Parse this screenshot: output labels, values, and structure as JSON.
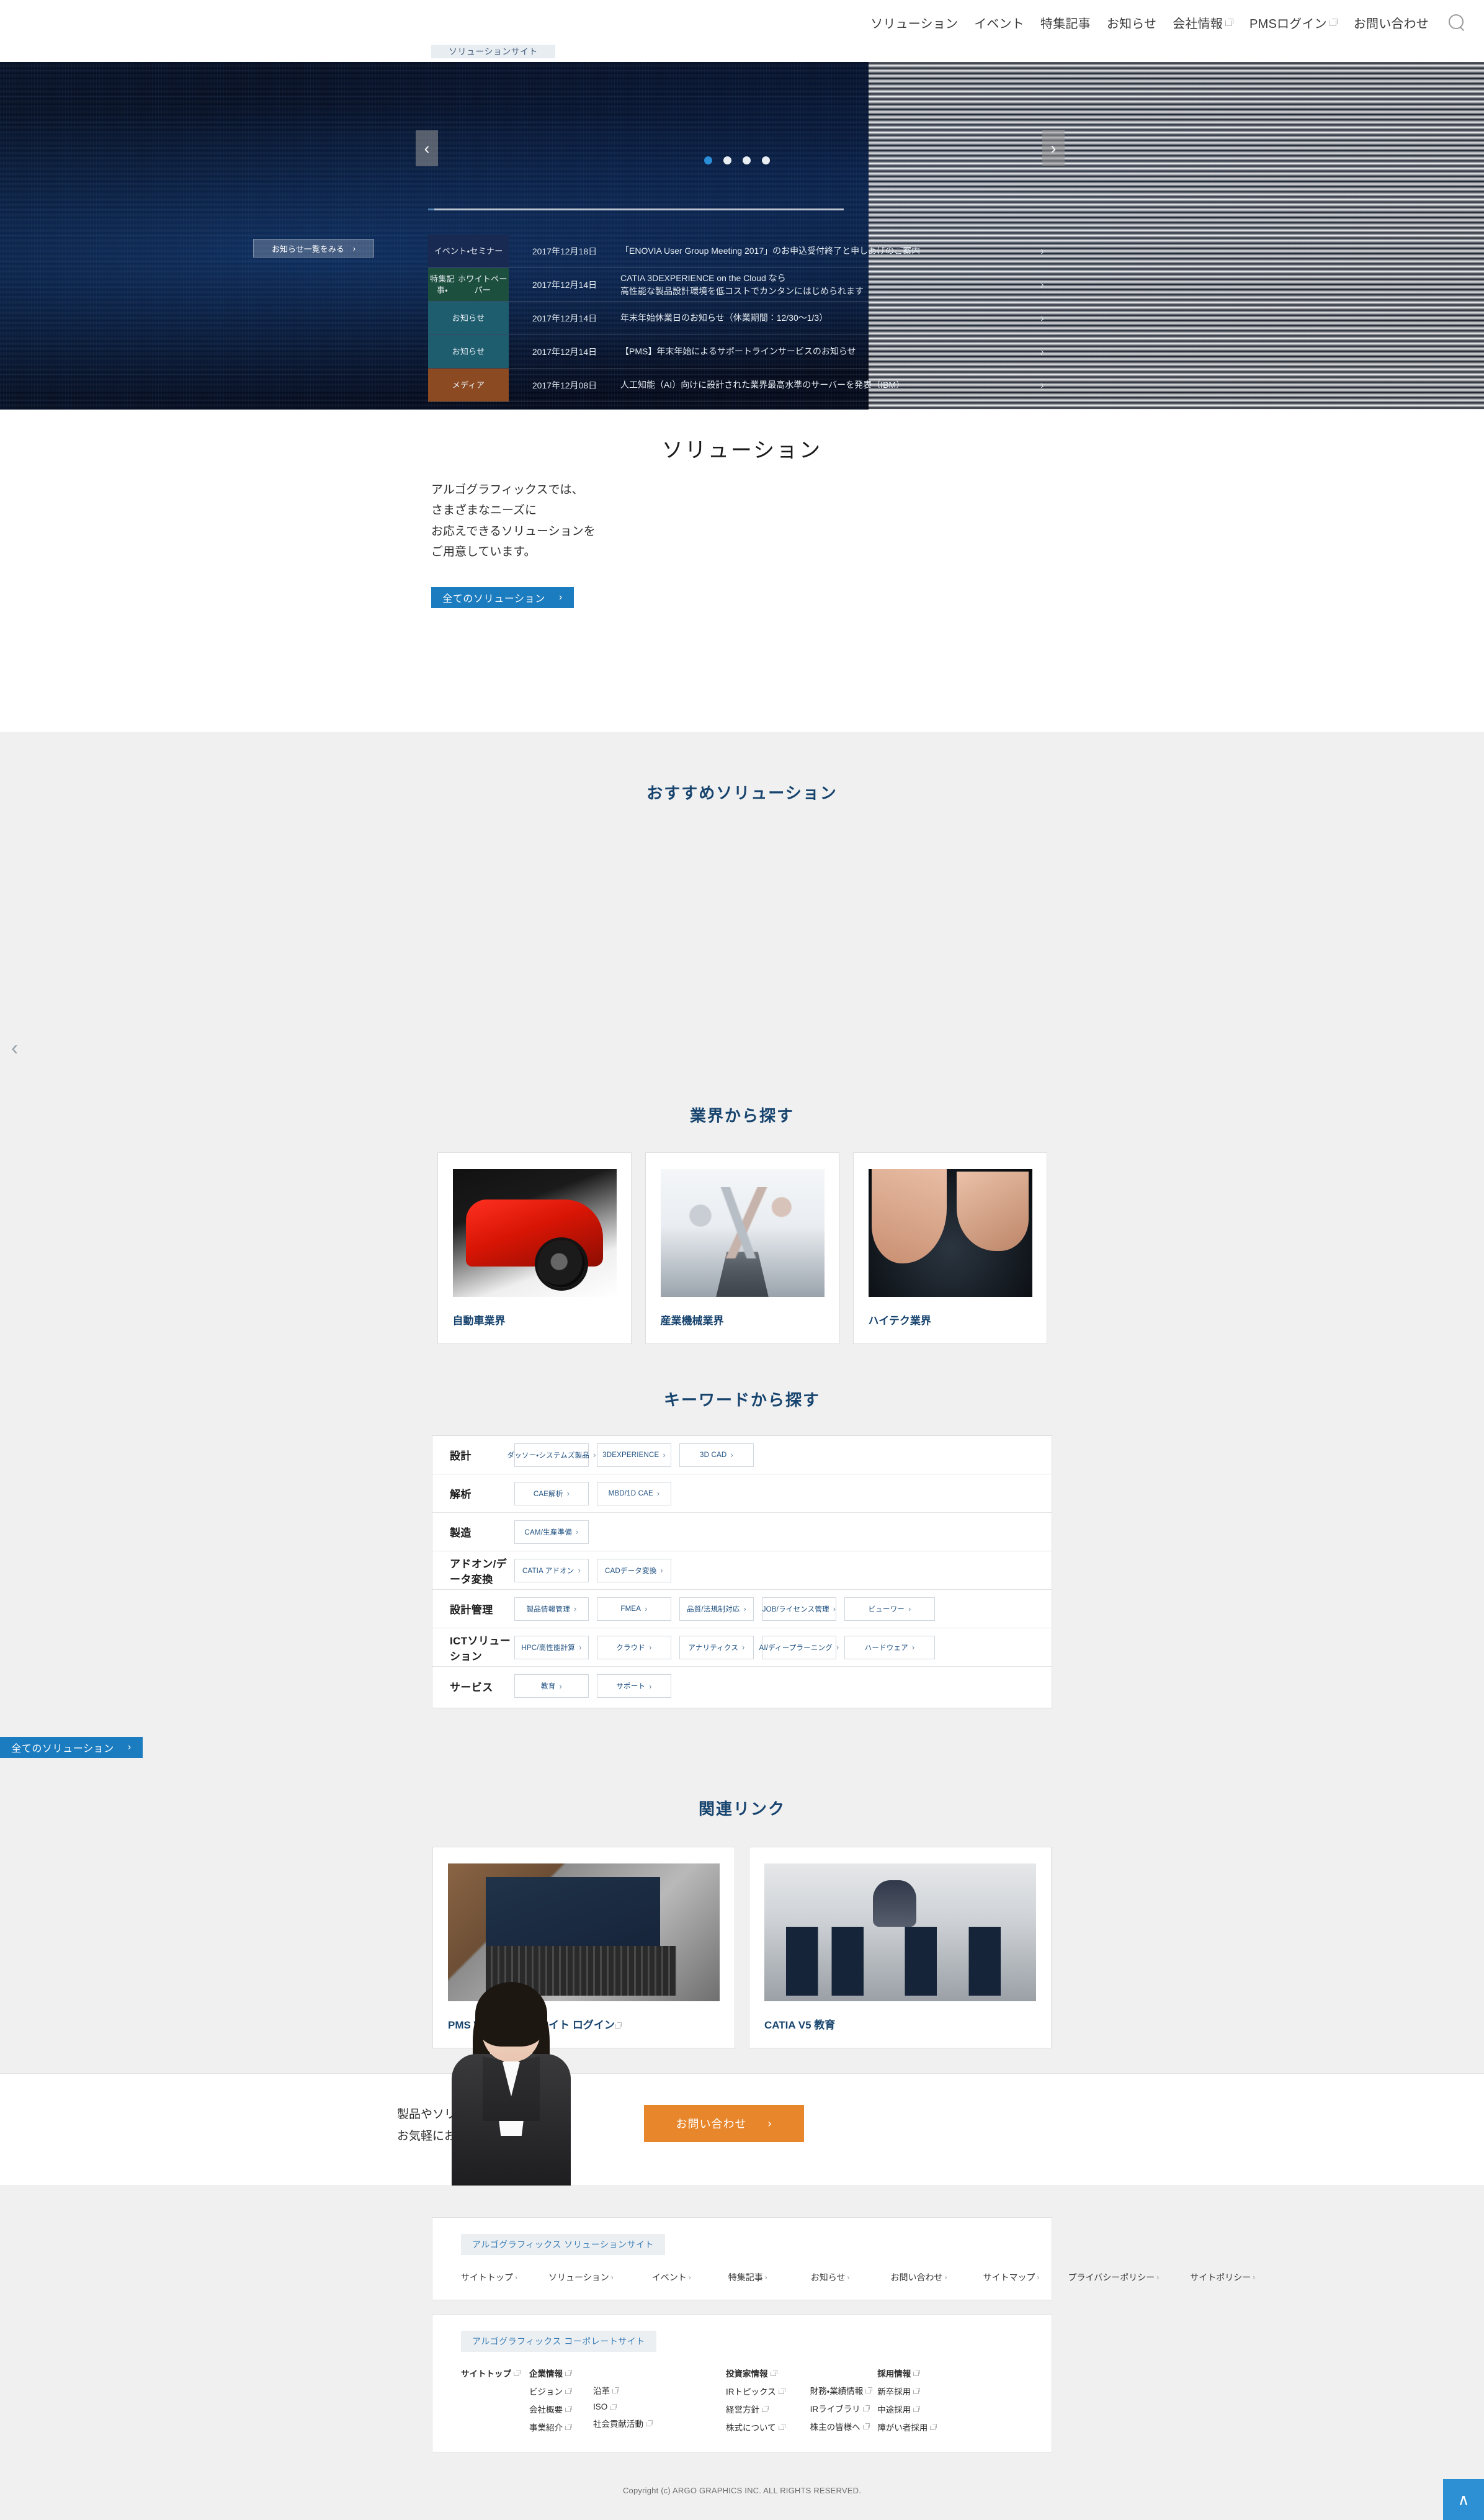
{
  "header": {
    "nav": [
      {
        "label": "ソリューション",
        "external": false
      },
      {
        "label": "イベント",
        "external": false
      },
      {
        "label": "特集記事",
        "external": false
      },
      {
        "label": "お知らせ",
        "external": false
      },
      {
        "label": "会社情報",
        "external": true
      },
      {
        "label": "PMSログイン",
        "external": true
      },
      {
        "label": "お問い合わせ",
        "external": false
      }
    ],
    "search_icon": "search-icon"
  },
  "breadcrumb": {
    "label": "ソリューションサイト"
  },
  "hero": {
    "prev_label": "‹",
    "next_label": "›",
    "dots": 4,
    "active_dot": 0,
    "more_label": "お知らせ一覧をみる",
    "more_chevron": "›",
    "news": [
      {
        "category": "イベント・\nセミナー",
        "date": "2017年12月18日",
        "title": "「ENOVIA User Group Meeting 2017」のお申込受付終了と申しあげのご案内",
        "chevron": "›"
      },
      {
        "category": "特集記事・\nホワイトペーパー",
        "date": "2017年12月14日",
        "title": "CATIA 3DEXPERIENCE on the Cloud なら\n高性能な製品設計環境を低コストでカンタンにはじめられます",
        "chevron": "›"
      },
      {
        "category": "お知らせ",
        "date": "2017年12月14日",
        "title": "年末年始休業日のお知らせ（休業期間：12/30～1/3）",
        "chevron": "›"
      },
      {
        "category": "お知らせ",
        "date": "2017年12月14日",
        "title": "【PMS】年末年始によるサポートラインサービスのお知らせ",
        "chevron": "›"
      },
      {
        "category": "メディア",
        "date": "2017年12月08日",
        "title": "人工知能（AI）向けに設計された業界最高水準のサーバーを発表（IBM）",
        "chevron": "›"
      }
    ]
  },
  "solution": {
    "title": "ソリューション",
    "body_lines": [
      "アルゴグラフィックスでは、",
      "さまざまなニーズに",
      "お応えできるソリューションを",
      "ご用意しています。"
    ],
    "button": "全てのソリューション",
    "button_chevron": "›"
  },
  "recommended": {
    "title": "おすすめソリューション",
    "prev_arrow": "‹"
  },
  "industry": {
    "title": "業界から探す",
    "cards": [
      {
        "label": "自動車業界",
        "thumb": "sports-car-photo"
      },
      {
        "label": "産業機械業界",
        "thumb": "industrial-robot-arms-photo"
      },
      {
        "label": "ハイテク業界",
        "thumb": "semiconductor-wafer-photo"
      }
    ]
  },
  "keyword": {
    "title": "キーワードから探す",
    "chevron": "›",
    "rows": [
      {
        "label": "設計",
        "items": [
          "ダッソー・システムズ製品",
          "3DEXPERIENCE",
          "3D CAD"
        ]
      },
      {
        "label": "解析",
        "items": [
          "CAE解析",
          "MBD/1D CAE"
        ]
      },
      {
        "label": "製造",
        "items": [
          "CAM/生産準備"
        ]
      },
      {
        "label": "アドオン/データ変換",
        "items": [
          "CATIA アドオン",
          "CADデータ変換"
        ]
      },
      {
        "label": "設計管理",
        "items": [
          "製品情報管理",
          "FMEA",
          "品質/法規制対応",
          "JOB/ライセンス管理",
          "ビューワー"
        ]
      },
      {
        "label": "ICTソリューション",
        "items": [
          "HPC/高性能計算",
          "クラウド",
          "アナリティクス",
          "AI/ディープラーニング",
          "ハードウェア"
        ]
      },
      {
        "label": "サービス",
        "items": [
          "教育",
          "サポート"
        ]
      }
    ],
    "all_button": "全てのソリューション",
    "all_button_chevron": "›"
  },
  "related": {
    "title": "関連リンク",
    "cards": [
      {
        "label": "PMS Webサポートサイト ログイン",
        "external": true,
        "thumb": "laptop-support-photo"
      },
      {
        "label": "CATIA V5 教育",
        "external": false,
        "thumb": "classroom-training-photo"
      }
    ]
  },
  "contact": {
    "line1": "製品やソリューションについて、",
    "line2": "お気軽にお問い合わせください。",
    "button": "お問い合わせ",
    "button_chevron": "›"
  },
  "footer": {
    "solution_site": {
      "tag": "アルゴグラフィックス ソリューションサイト",
      "links": [
        {
          "label": "サイトトップ"
        },
        {
          "label": "ソリューション"
        },
        {
          "label": "イベント"
        },
        {
          "label": "特集記事"
        },
        {
          "label": "お知らせ"
        },
        {
          "label": "お問い合わせ"
        },
        {
          "label": "サイトマップ"
        },
        {
          "label": "プライバシーポリシー"
        },
        {
          "label": "サイトポリシー"
        }
      ],
      "chevron": "›"
    },
    "corporate_site": {
      "tag": "アルゴグラフィックス コーポレートサイト",
      "columns": [
        {
          "head": "サイトトップ",
          "items": []
        },
        {
          "head": "企業情報",
          "items": [
            "ビジョン",
            "会社概要",
            "事業紹介"
          ]
        },
        {
          "head": "",
          "items": [
            "沿革",
            "ISO",
            "社会貢献活動"
          ]
        },
        {
          "head": "投資家情報",
          "items": [
            "IRトピックス",
            "経営方針",
            "株式について"
          ]
        },
        {
          "head": "",
          "items": [
            "財務・業績情報",
            "IRライブラリ",
            "株主の皆様へ"
          ]
        },
        {
          "head": "採用情報",
          "items": [
            "新卒採用",
            "中途採用",
            "障がい者採用"
          ]
        }
      ]
    },
    "copyright": "Copyright (c) ARGO GRAPHICS INC. ALL RIGHTS RESERVED.",
    "to_top": "∧"
  }
}
